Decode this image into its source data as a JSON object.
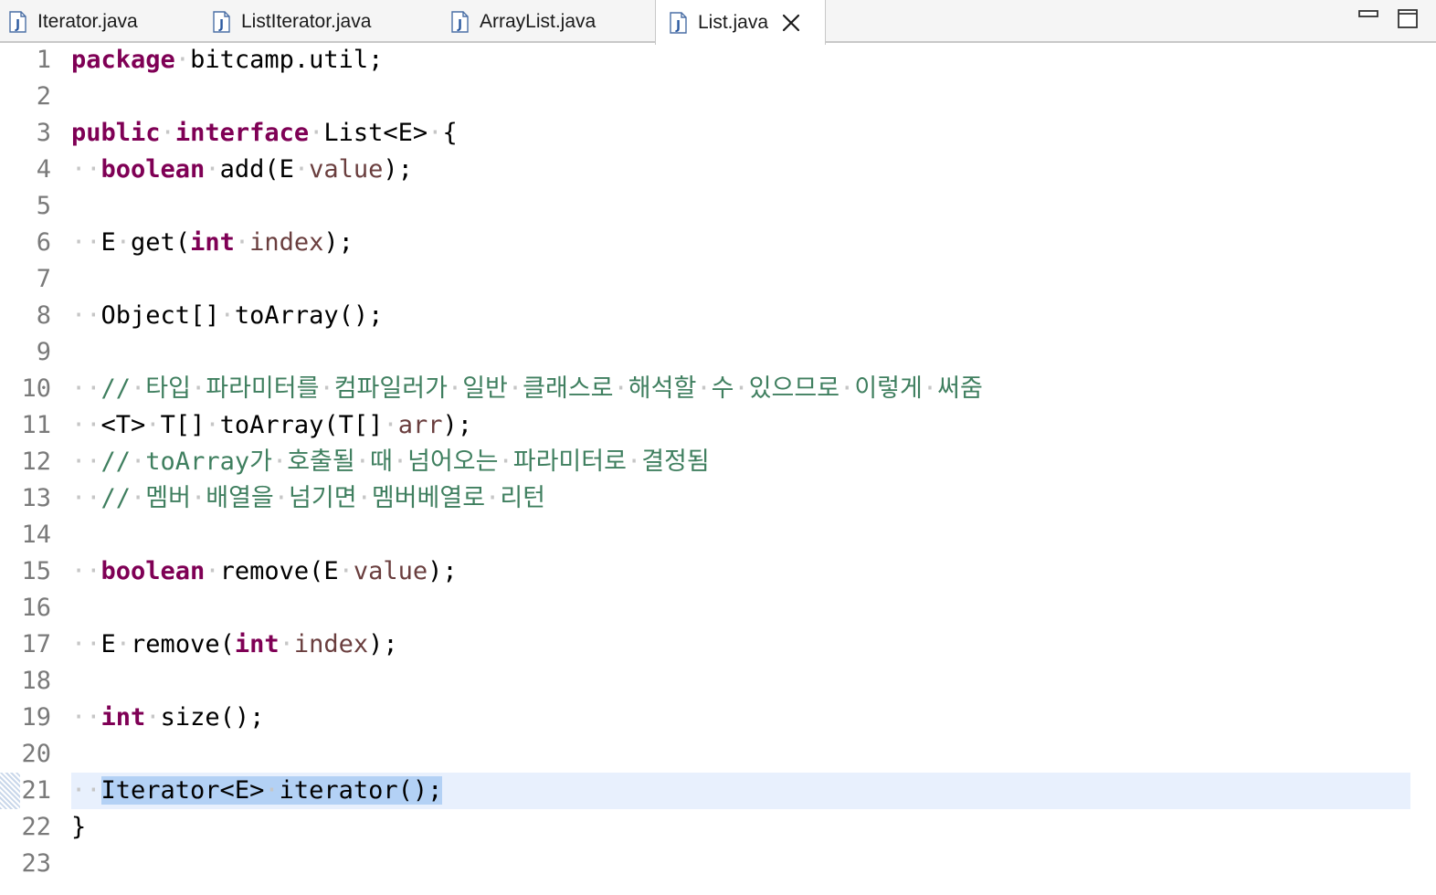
{
  "tabs": [
    {
      "label": "Iterator.java",
      "active": false
    },
    {
      "label": "ListIterator.java",
      "active": false
    },
    {
      "label": "ArrayList.java",
      "active": false
    },
    {
      "label": "List.java",
      "active": true
    }
  ],
  "editor": {
    "current_line": "21",
    "lines": [
      {
        "n": "1",
        "text": "package bitcamp.util;"
      },
      {
        "n": "2",
        "text": ""
      },
      {
        "n": "3",
        "text": "public interface List<E> {"
      },
      {
        "n": "4",
        "text": "  boolean add(E value);"
      },
      {
        "n": "5",
        "text": ""
      },
      {
        "n": "6",
        "text": "  E get(int index);"
      },
      {
        "n": "7",
        "text": ""
      },
      {
        "n": "8",
        "text": "  Object[] toArray();"
      },
      {
        "n": "9",
        "text": ""
      },
      {
        "n": "10",
        "text": "  // 타입 파라미터를 컴파일러가 일반 클래스로 해석할 수 있으므로 이렇게 써줌"
      },
      {
        "n": "11",
        "text": "  <T> T[] toArray(T[] arr);"
      },
      {
        "n": "12",
        "text": "  // toArray가 호출될 때 넘어오는 파라미터로 결정됨"
      },
      {
        "n": "13",
        "text": "  // 멤버 배열을 넘기면 멤버베열로 리턴"
      },
      {
        "n": "14",
        "text": ""
      },
      {
        "n": "15",
        "text": "  boolean remove(E value);"
      },
      {
        "n": "16",
        "text": ""
      },
      {
        "n": "17",
        "text": "  E remove(int index);"
      },
      {
        "n": "18",
        "text": ""
      },
      {
        "n": "19",
        "text": "  int size();"
      },
      {
        "n": "20",
        "text": ""
      },
      {
        "n": "21",
        "text": "  Iterator<E> iterator();"
      },
      {
        "n": "22",
        "text": "}"
      },
      {
        "n": "23",
        "text": ""
      }
    ]
  },
  "colors": {
    "keyword": "#7f0055",
    "comment": "#3f7f5f",
    "parameter": "#6a3e3e",
    "line_number": "#7a7a7a",
    "current_line_bg": "#e8f0fd",
    "selection_bg": "#b3d1f5"
  },
  "icons": {
    "file_icon": "java-file-icon",
    "close": "close-icon",
    "minimize": "minimize-icon",
    "maximize": "maximize-icon"
  }
}
